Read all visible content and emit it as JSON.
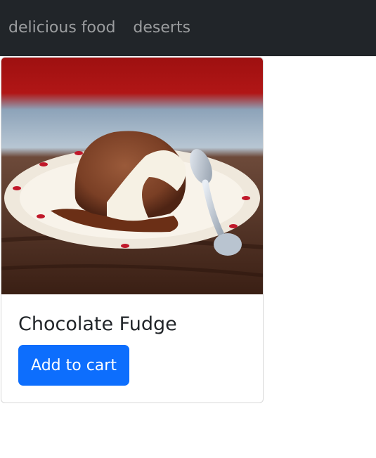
{
  "navbar": {
    "links": [
      {
        "label": "delicious food"
      },
      {
        "label": "deserts"
      }
    ]
  },
  "product": {
    "title": "Chocolate Fudge",
    "button_label": "Add to cart",
    "image_alt_icon": "chocolate-fudge-image"
  },
  "colors": {
    "navbar_bg": "#212529",
    "button_primary": "#0d6efd",
    "text_dark": "#212529"
  }
}
